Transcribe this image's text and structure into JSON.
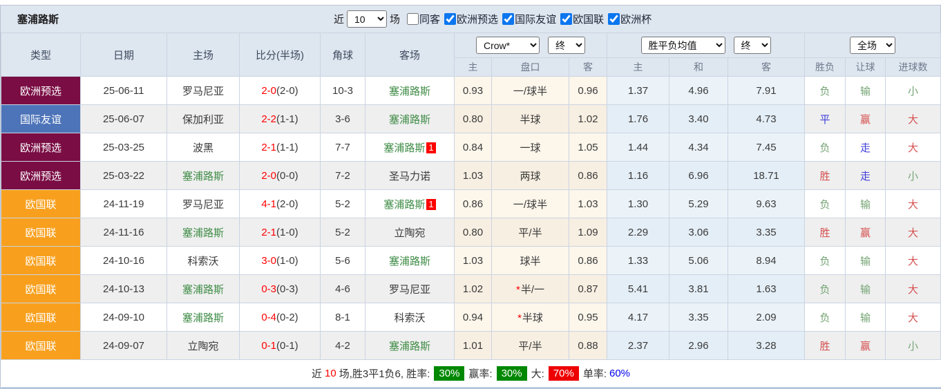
{
  "header": {
    "title": "塞浦路斯",
    "recent_label": "近",
    "recent_value": "10",
    "matches_label": "场",
    "same_away": {
      "label": "同客",
      "checked": false
    },
    "filters": [
      {
        "label": "欧洲预选",
        "checked": true
      },
      {
        "label": "国际友谊",
        "checked": true
      },
      {
        "label": "欧国联",
        "checked": true
      },
      {
        "label": "欧洲杯",
        "checked": true
      }
    ]
  },
  "table": {
    "main_headers": [
      "类型",
      "日期",
      "主场",
      "比分(半场)",
      "角球",
      "客场"
    ],
    "selects": {
      "company": "Crow*",
      "company_time": "终",
      "average": "胜平负均值",
      "average_time": "终",
      "scope": "全场"
    },
    "sub_headers": [
      "主",
      "盘口",
      "客",
      "主",
      "和",
      "客",
      "胜负",
      "让球",
      "进球数"
    ],
    "rows": [
      {
        "type": "欧洲预选",
        "tc": "maroon",
        "date": "25-06-11",
        "home": "罗马尼亚",
        "hg": false,
        "score": "2-0",
        "half": "(2-0)",
        "corner": "10-3",
        "away": "塞浦路斯",
        "ag": true,
        "badge": "",
        "o1": "0.93",
        "hcp": "一/球半",
        "star": false,
        "o2": "0.96",
        "a1": "1.37",
        "a2": "4.96",
        "a3": "7.91",
        "res": {
          "t": "负",
          "c": "green"
        },
        "hres": {
          "t": "输",
          "c": "green"
        },
        "goals": {
          "t": "小",
          "c": "green"
        }
      },
      {
        "type": "国际友谊",
        "tc": "blue",
        "date": "25-06-07",
        "home": "保加利亚",
        "hg": false,
        "score": "2-2",
        "half": "(1-1)",
        "corner": "3-6",
        "away": "塞浦路斯",
        "ag": true,
        "badge": "",
        "o1": "0.80",
        "hcp": "半球",
        "star": false,
        "o2": "1.02",
        "a1": "1.76",
        "a2": "3.40",
        "a3": "4.73",
        "res": {
          "t": "平",
          "c": "blue"
        },
        "hres": {
          "t": "赢",
          "c": "red"
        },
        "goals": {
          "t": "大",
          "c": "red"
        }
      },
      {
        "type": "欧洲预选",
        "tc": "maroon",
        "date": "25-03-25",
        "home": "波黑",
        "hg": false,
        "score": "2-1",
        "half": "(1-1)",
        "corner": "7-7",
        "away": "塞浦路斯",
        "ag": true,
        "badge": "1",
        "o1": "0.84",
        "hcp": "一球",
        "star": false,
        "o2": "1.05",
        "a1": "1.44",
        "a2": "4.34",
        "a3": "7.45",
        "res": {
          "t": "负",
          "c": "green"
        },
        "hres": {
          "t": "走",
          "c": "blue"
        },
        "goals": {
          "t": "大",
          "c": "red"
        }
      },
      {
        "type": "欧洲预选",
        "tc": "maroon",
        "date": "25-03-22",
        "home": "塞浦路斯",
        "hg": true,
        "score": "2-0",
        "half": "(0-0)",
        "corner": "7-2",
        "away": "圣马力诺",
        "ag": false,
        "badge": "",
        "o1": "1.03",
        "hcp": "两球",
        "star": false,
        "o2": "0.86",
        "a1": "1.16",
        "a2": "6.96",
        "a3": "18.71",
        "res": {
          "t": "胜",
          "c": "red"
        },
        "hres": {
          "t": "走",
          "c": "blue"
        },
        "goals": {
          "t": "小",
          "c": "green"
        }
      },
      {
        "type": "欧国联",
        "tc": "orange",
        "date": "24-11-19",
        "home": "罗马尼亚",
        "hg": false,
        "score": "4-1",
        "half": "(2-0)",
        "corner": "5-2",
        "away": "塞浦路斯",
        "ag": true,
        "badge": "1",
        "o1": "0.86",
        "hcp": "一/球半",
        "star": false,
        "o2": "1.03",
        "a1": "1.30",
        "a2": "5.29",
        "a3": "9.63",
        "res": {
          "t": "负",
          "c": "green"
        },
        "hres": {
          "t": "输",
          "c": "green"
        },
        "goals": {
          "t": "大",
          "c": "red"
        }
      },
      {
        "type": "欧国联",
        "tc": "orange",
        "date": "24-11-16",
        "home": "塞浦路斯",
        "hg": true,
        "score": "2-1",
        "half": "(1-0)",
        "corner": "5-2",
        "away": "立陶宛",
        "ag": false,
        "badge": "",
        "o1": "0.80",
        "hcp": "平/半",
        "star": false,
        "o2": "1.09",
        "a1": "2.29",
        "a2": "3.06",
        "a3": "3.35",
        "res": {
          "t": "胜",
          "c": "red"
        },
        "hres": {
          "t": "赢",
          "c": "red"
        },
        "goals": {
          "t": "大",
          "c": "red"
        }
      },
      {
        "type": "欧国联",
        "tc": "orange",
        "date": "24-10-16",
        "home": "科索沃",
        "hg": false,
        "score": "3-0",
        "half": "(1-0)",
        "corner": "5-6",
        "away": "塞浦路斯",
        "ag": true,
        "badge": "",
        "o1": "1.03",
        "hcp": "球半",
        "star": false,
        "o2": "0.86",
        "a1": "1.33",
        "a2": "5.06",
        "a3": "8.94",
        "res": {
          "t": "负",
          "c": "green"
        },
        "hres": {
          "t": "输",
          "c": "green"
        },
        "goals": {
          "t": "大",
          "c": "red"
        }
      },
      {
        "type": "欧国联",
        "tc": "orange",
        "date": "24-10-13",
        "home": "塞浦路斯",
        "hg": true,
        "score": "0-3",
        "half": "(0-3)",
        "corner": "4-6",
        "away": "罗马尼亚",
        "ag": false,
        "badge": "",
        "o1": "1.02",
        "hcp": "半/一",
        "star": true,
        "o2": "0.87",
        "a1": "5.41",
        "a2": "3.81",
        "a3": "1.63",
        "res": {
          "t": "负",
          "c": "green"
        },
        "hres": {
          "t": "输",
          "c": "green"
        },
        "goals": {
          "t": "大",
          "c": "red"
        }
      },
      {
        "type": "欧国联",
        "tc": "orange",
        "date": "24-09-10",
        "home": "塞浦路斯",
        "hg": true,
        "score": "0-4",
        "half": "(0-2)",
        "corner": "8-1",
        "away": "科索沃",
        "ag": false,
        "badge": "",
        "o1": "0.94",
        "hcp": "半球",
        "star": true,
        "o2": "0.95",
        "a1": "4.17",
        "a2": "3.35",
        "a3": "2.09",
        "res": {
          "t": "负",
          "c": "green"
        },
        "hres": {
          "t": "输",
          "c": "green"
        },
        "goals": {
          "t": "大",
          "c": "red"
        }
      },
      {
        "type": "欧国联",
        "tc": "orange",
        "date": "24-09-07",
        "home": "立陶宛",
        "hg": false,
        "score": "0-1",
        "half": "(0-1)",
        "corner": "4-2",
        "away": "塞浦路斯",
        "ag": true,
        "badge": "",
        "o1": "1.01",
        "hcp": "平/半",
        "star": false,
        "o2": "0.88",
        "a1": "2.37",
        "a2": "2.96",
        "a3": "3.28",
        "res": {
          "t": "胜",
          "c": "red"
        },
        "hres": {
          "t": "赢",
          "c": "red"
        },
        "goals": {
          "t": "小",
          "c": "green"
        }
      }
    ]
  },
  "footer": {
    "prefix": "近",
    "count": "10",
    "summary": "场,胜3平1负6, 胜率:",
    "win_rate": "30%",
    "handicap_label": "赢率:",
    "handicap_rate": "30%",
    "big_label": "大:",
    "big_rate": "70%",
    "single_label": "单率:",
    "single_rate": "60%"
  },
  "colors": {
    "maroon": "#7A0D44",
    "blue": "#4D74B9",
    "orange": "#F8A01E",
    "team_green": "#3F8C46",
    "score_red": "#FF0000",
    "res_red": "#D65050",
    "res_green": "#74A474",
    "res_blue": "#4040D9",
    "pct_green": "#008800",
    "pct_red": "#EE0000",
    "pct_blue": "#0000EE"
  }
}
